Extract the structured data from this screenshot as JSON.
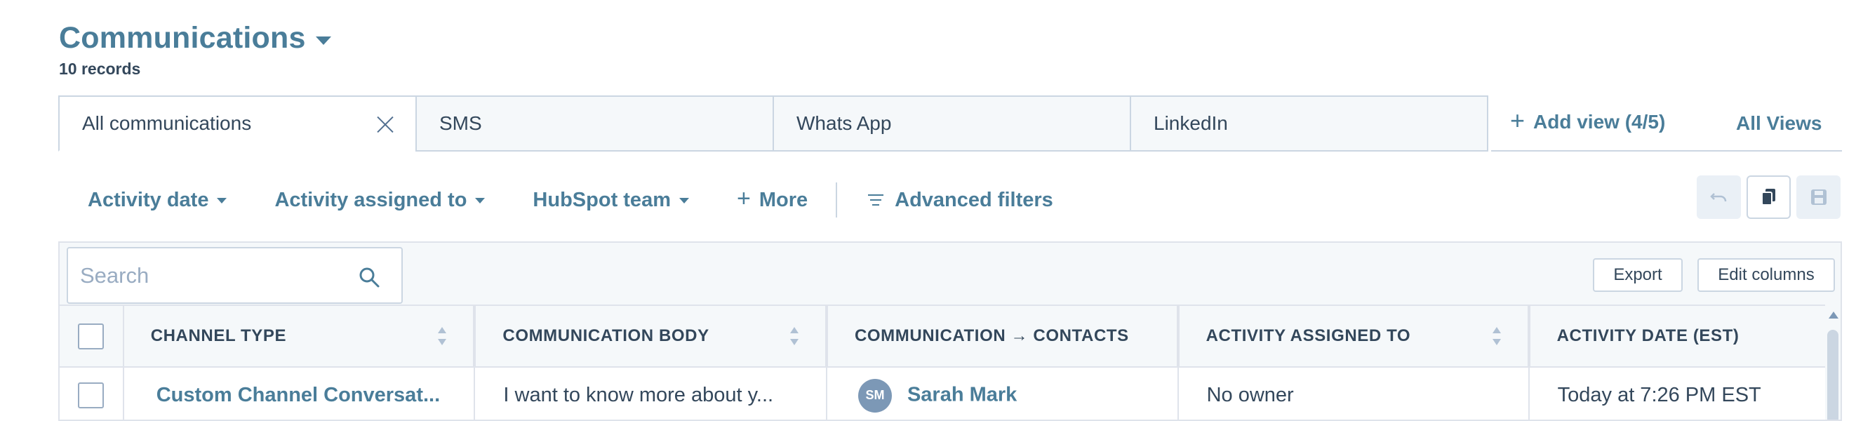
{
  "header": {
    "title": "Communications",
    "record_count": "10 records"
  },
  "tabs": [
    {
      "label": "All communications",
      "active": true
    },
    {
      "label": "SMS",
      "active": false
    },
    {
      "label": "Whats App",
      "active": false
    },
    {
      "label": "LinkedIn",
      "active": false
    }
  ],
  "view_actions": {
    "add_view": "Add view (4/5)",
    "all_views": "All Views"
  },
  "filters": {
    "activity_date": "Activity date",
    "activity_assigned_to": "Activity assigned to",
    "hubspot_team": "HubSpot team",
    "more": "More",
    "advanced_filters": "Advanced filters"
  },
  "toolbar_icons": [
    "undo-icon",
    "copy-icon",
    "save-icon"
  ],
  "search": {
    "placeholder": "Search",
    "value": ""
  },
  "table_actions": {
    "export": "Export",
    "edit_columns": "Edit columns"
  },
  "table": {
    "columns": [
      "CHANNEL TYPE",
      "COMMUNICATION BODY",
      "COMMUNICATION → CONTACTS",
      "ACTIVITY ASSIGNED TO",
      "ACTIVITY DATE (EST)"
    ],
    "rows": [
      {
        "channel_type": "Custom Channel Conversat...",
        "body": "I want to know more about y...",
        "contact_initials": "SM",
        "contact_name": "Sarah Mark",
        "assigned_to": "No owner",
        "activity_date": "Today at 7:26 PM EST"
      }
    ]
  },
  "colors": {
    "accent": "#4a7d99",
    "text": "#33475b",
    "border": "#cbd6e2",
    "panel_bg": "#f5f8fa",
    "avatar_bg": "#7c98b6"
  }
}
